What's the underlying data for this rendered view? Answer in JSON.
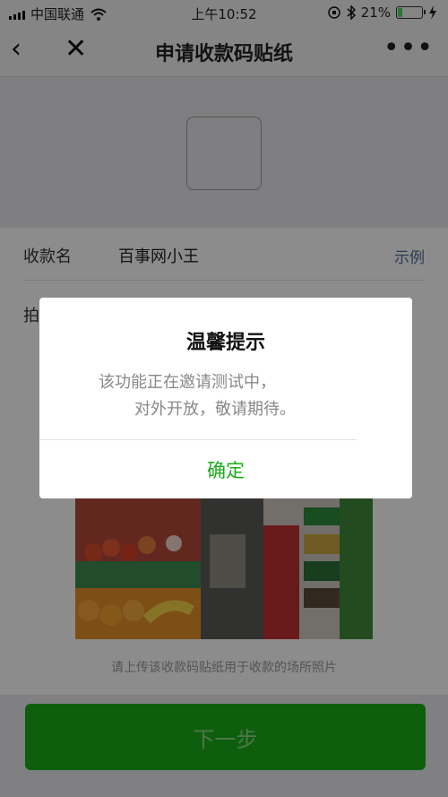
{
  "status_bar": {
    "carrier": "中国联通",
    "time": "上午10:52",
    "battery": "21%",
    "battery_level": 0.21,
    "wifi_icon": "wifi-icon",
    "bluetooth_icon": "bluetooth-icon",
    "charging_icon": "lightning-icon"
  },
  "nav": {
    "title": "申请收款码贴纸",
    "back_icon": "‹",
    "close_icon": "✕",
    "more_icon": "•••"
  },
  "form": {
    "name_label": "收款名",
    "name_value": "百事网小王",
    "example_link": "示例",
    "photo_label": "拍",
    "photo_caption": "请上传该收款码贴纸用于收款的场所照片"
  },
  "footer": {
    "next_button": "下一步"
  },
  "dialog": {
    "title": "温馨提示",
    "line1": "该功能正在邀请测试中，",
    "line2": "对外开放，敬请期待。",
    "ok_button": "确定"
  },
  "colors": {
    "accent": "#1aad19",
    "link": "#4a6a95"
  }
}
